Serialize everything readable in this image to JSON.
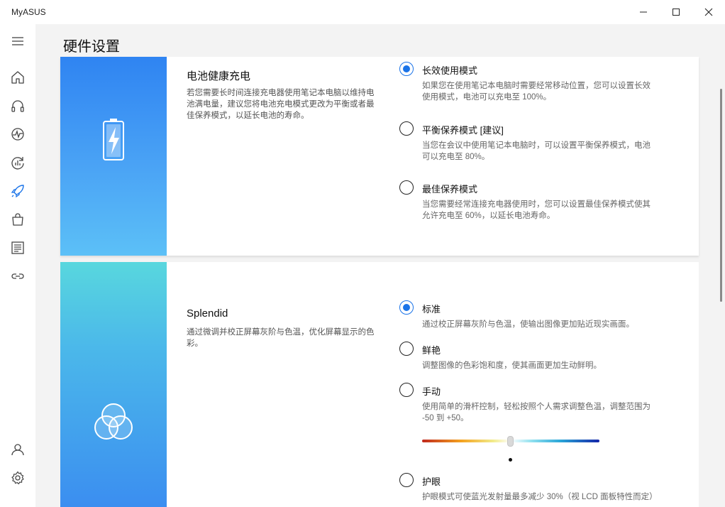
{
  "window": {
    "title": "MyASUS",
    "minimize_icon": "minimize-icon",
    "maximize_icon": "maximize-icon",
    "close_icon": "close-icon"
  },
  "sidebar": {
    "items": [
      {
        "icon": "menu-icon"
      },
      {
        "icon": "home-icon"
      },
      {
        "icon": "headset-icon"
      },
      {
        "icon": "diagnostics-icon"
      },
      {
        "icon": "system-update-icon"
      },
      {
        "icon": "rocket-icon",
        "active": true
      },
      {
        "icon": "store-bag-icon"
      },
      {
        "icon": "news-icon"
      },
      {
        "icon": "link-icon"
      },
      {
        "icon": "user-icon"
      },
      {
        "icon": "settings-gear-icon"
      }
    ],
    "active_color": "#1a73e8"
  },
  "page": {
    "title": "硬件设置"
  },
  "battery": {
    "title": "电池健康充电",
    "description": "若您需要长时间连接充电器使用笔记本电脑以维持电池满电量，建议您将电池充电模式更改为平衡或者最佳保养模式，以延长电池的寿命。",
    "icon": "battery-charging-icon",
    "options": [
      {
        "label": "长效使用模式",
        "description": "如果您在使用笔记本电脑时需要经常移动位置，您可以设置长效使用模式，电池可以充电至 100%。",
        "selected": true
      },
      {
        "label": "平衡保养模式 [建议]",
        "description": "当您在会议中使用笔记本电脑时，可以设置平衡保养模式，电池可以充电至 80%。",
        "selected": false
      },
      {
        "label": "最佳保养模式",
        "description": "当您需要经常连接充电器使用时，您可以设置最佳保养模式使其允许充电至 60%，以延长电池寿命。",
        "selected": false
      }
    ]
  },
  "splendid": {
    "title": "Splendid",
    "description": "通过微调并校正屏幕灰阶与色温，优化屏幕显示的色彩。",
    "icon": "color-circles-icon",
    "options": [
      {
        "label": "标准",
        "description": "通过校正屏幕灰阶与色温，使输出图像更加贴近现实画面。",
        "selected": true
      },
      {
        "label": "鲜艳",
        "description": "调整图像的色彩饱和度，使其画面更加生动鲜明。",
        "selected": false
      },
      {
        "label": "手动",
        "description": "使用简单的滑杆控制，轻松按照个人需求调整色温，调整范围为 -50 到 +50。",
        "selected": false
      },
      {
        "label": "护眼",
        "description": "护眼模式可使蓝光发射量最多减少 30%（视 LCD 面板特性而定）",
        "selected": false
      }
    ],
    "color_temp_slider": {
      "min": -50,
      "max": 50,
      "value": 0
    }
  }
}
